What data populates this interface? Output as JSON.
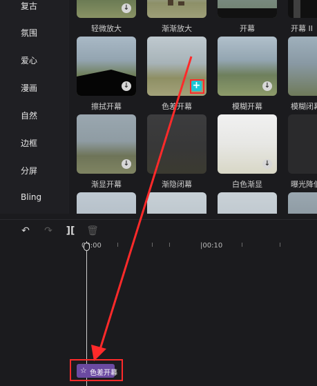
{
  "sidebar": {
    "items": [
      {
        "label": "复古"
      },
      {
        "label": "氛围"
      },
      {
        "label": "爱心"
      },
      {
        "label": "漫画"
      },
      {
        "label": "自然"
      },
      {
        "label": "边框"
      },
      {
        "label": "分屏"
      },
      {
        "label": "Bling"
      }
    ]
  },
  "effects_grid": {
    "row1": [
      "轻微放大",
      "渐渐放大",
      "开幕",
      "开幕 II"
    ],
    "row2": [
      "擦拭开幕",
      "色差开幕",
      "模糊开幕",
      "模糊闭幕"
    ],
    "row3": [
      "渐显开幕",
      "渐隐闭幕",
      "白色渐显",
      "曝光降低"
    ],
    "download_icon": "download-icon",
    "add_icon": "plus-icon",
    "add_icon_color": "#1cc5d6"
  },
  "timeline": {
    "time_start": "00:00",
    "time_mark": "|00:10",
    "tool_icons": [
      "undo-icon",
      "redo-icon",
      "split-icon",
      "delete-icon"
    ],
    "clip": {
      "icon": "star-icon",
      "label": "色差开幕",
      "color": "#6b4aa1"
    }
  },
  "annotations": {
    "highlight_color": "#ff2a2a"
  }
}
